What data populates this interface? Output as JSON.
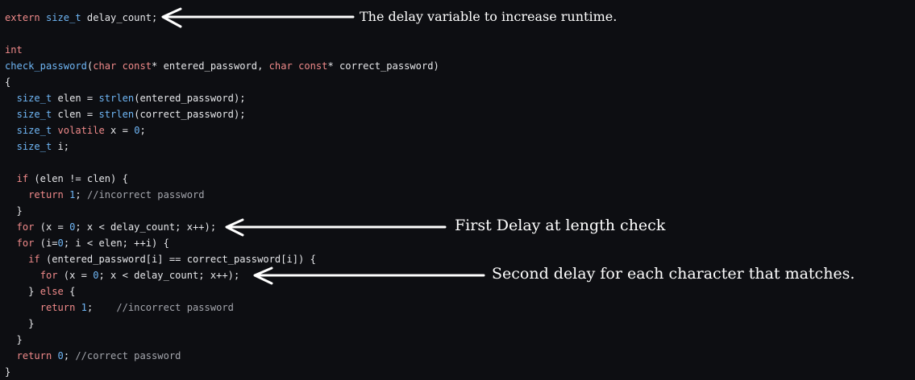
{
  "code": {
    "lines": [
      [
        {
          "t": "kw",
          "v": "extern"
        },
        {
          "t": "txt",
          "v": " "
        },
        {
          "t": "ty",
          "v": "size_t"
        },
        {
          "t": "txt",
          "v": " delay_count;"
        }
      ],
      [],
      [
        {
          "t": "kw",
          "v": "int"
        }
      ],
      [
        {
          "t": "fn",
          "v": "check_password"
        },
        {
          "t": "txt",
          "v": "("
        },
        {
          "t": "kw",
          "v": "char"
        },
        {
          "t": "txt",
          "v": " "
        },
        {
          "t": "kw",
          "v": "const"
        },
        {
          "t": "txt",
          "v": "* entered_password, "
        },
        {
          "t": "kw",
          "v": "char"
        },
        {
          "t": "txt",
          "v": " "
        },
        {
          "t": "kw",
          "v": "const"
        },
        {
          "t": "txt",
          "v": "* correct_password)"
        }
      ],
      [
        {
          "t": "txt",
          "v": "{"
        }
      ],
      [
        {
          "t": "txt",
          "v": "  "
        },
        {
          "t": "ty",
          "v": "size_t"
        },
        {
          "t": "txt",
          "v": " elen = "
        },
        {
          "t": "fn",
          "v": "strlen"
        },
        {
          "t": "txt",
          "v": "(entered_password);"
        }
      ],
      [
        {
          "t": "txt",
          "v": "  "
        },
        {
          "t": "ty",
          "v": "size_t"
        },
        {
          "t": "txt",
          "v": " clen = "
        },
        {
          "t": "fn",
          "v": "strlen"
        },
        {
          "t": "txt",
          "v": "(correct_password);"
        }
      ],
      [
        {
          "t": "txt",
          "v": "  "
        },
        {
          "t": "ty",
          "v": "size_t"
        },
        {
          "t": "txt",
          "v": " "
        },
        {
          "t": "kw",
          "v": "volatile"
        },
        {
          "t": "txt",
          "v": " x = "
        },
        {
          "t": "num",
          "v": "0"
        },
        {
          "t": "txt",
          "v": ";"
        }
      ],
      [
        {
          "t": "txt",
          "v": "  "
        },
        {
          "t": "ty",
          "v": "size_t"
        },
        {
          "t": "txt",
          "v": " i;"
        }
      ],
      [],
      [
        {
          "t": "txt",
          "v": "  "
        },
        {
          "t": "kw",
          "v": "if"
        },
        {
          "t": "txt",
          "v": " (elen != clen) {"
        }
      ],
      [
        {
          "t": "txt",
          "v": "    "
        },
        {
          "t": "kw",
          "v": "return"
        },
        {
          "t": "txt",
          "v": " "
        },
        {
          "t": "num",
          "v": "1"
        },
        {
          "t": "txt",
          "v": "; "
        },
        {
          "t": "cm",
          "v": "//incorrect password"
        }
      ],
      [
        {
          "t": "txt",
          "v": "  }"
        }
      ],
      [
        {
          "t": "txt",
          "v": "  "
        },
        {
          "t": "kw",
          "v": "for"
        },
        {
          "t": "txt",
          "v": " (x = "
        },
        {
          "t": "num",
          "v": "0"
        },
        {
          "t": "txt",
          "v": "; x < delay_count; x++);"
        }
      ],
      [
        {
          "t": "txt",
          "v": "  "
        },
        {
          "t": "kw",
          "v": "for"
        },
        {
          "t": "txt",
          "v": " (i="
        },
        {
          "t": "num",
          "v": "0"
        },
        {
          "t": "txt",
          "v": "; i < elen; ++i) {"
        }
      ],
      [
        {
          "t": "txt",
          "v": "    "
        },
        {
          "t": "kw",
          "v": "if"
        },
        {
          "t": "txt",
          "v": " (entered_password[i] == correct_password[i]) {"
        }
      ],
      [
        {
          "t": "txt",
          "v": "      "
        },
        {
          "t": "kw",
          "v": "for"
        },
        {
          "t": "txt",
          "v": " (x = "
        },
        {
          "t": "num",
          "v": "0"
        },
        {
          "t": "txt",
          "v": "; x < delay_count; x++);"
        }
      ],
      [
        {
          "t": "txt",
          "v": "    } "
        },
        {
          "t": "kw",
          "v": "else"
        },
        {
          "t": "txt",
          "v": " {"
        }
      ],
      [
        {
          "t": "txt",
          "v": "      "
        },
        {
          "t": "kw",
          "v": "return"
        },
        {
          "t": "txt",
          "v": " "
        },
        {
          "t": "num",
          "v": "1"
        },
        {
          "t": "txt",
          "v": ";    "
        },
        {
          "t": "cm",
          "v": "//incorrect password"
        }
      ],
      [
        {
          "t": "txt",
          "v": "    }"
        }
      ],
      [
        {
          "t": "txt",
          "v": "  }"
        }
      ],
      [
        {
          "t": "txt",
          "v": "  "
        },
        {
          "t": "kw",
          "v": "return"
        },
        {
          "t": "txt",
          "v": " "
        },
        {
          "t": "num",
          "v": "0"
        },
        {
          "t": "txt",
          "v": "; "
        },
        {
          "t": "cm",
          "v": "//correct password"
        }
      ],
      [
        {
          "t": "txt",
          "v": "}"
        }
      ]
    ]
  },
  "annotations": {
    "delay_variable": "The delay variable to increase runtime.",
    "first_delay": "First Delay at length check",
    "second_delay": "Second delay for each character that matches."
  },
  "colors": {
    "background": "#0d0e12",
    "keyword": "#f08a8a",
    "type": "#6fb6f5",
    "text": "#e6e7ea",
    "comment": "#a4a6ad",
    "annotation": "#ffffff"
  }
}
